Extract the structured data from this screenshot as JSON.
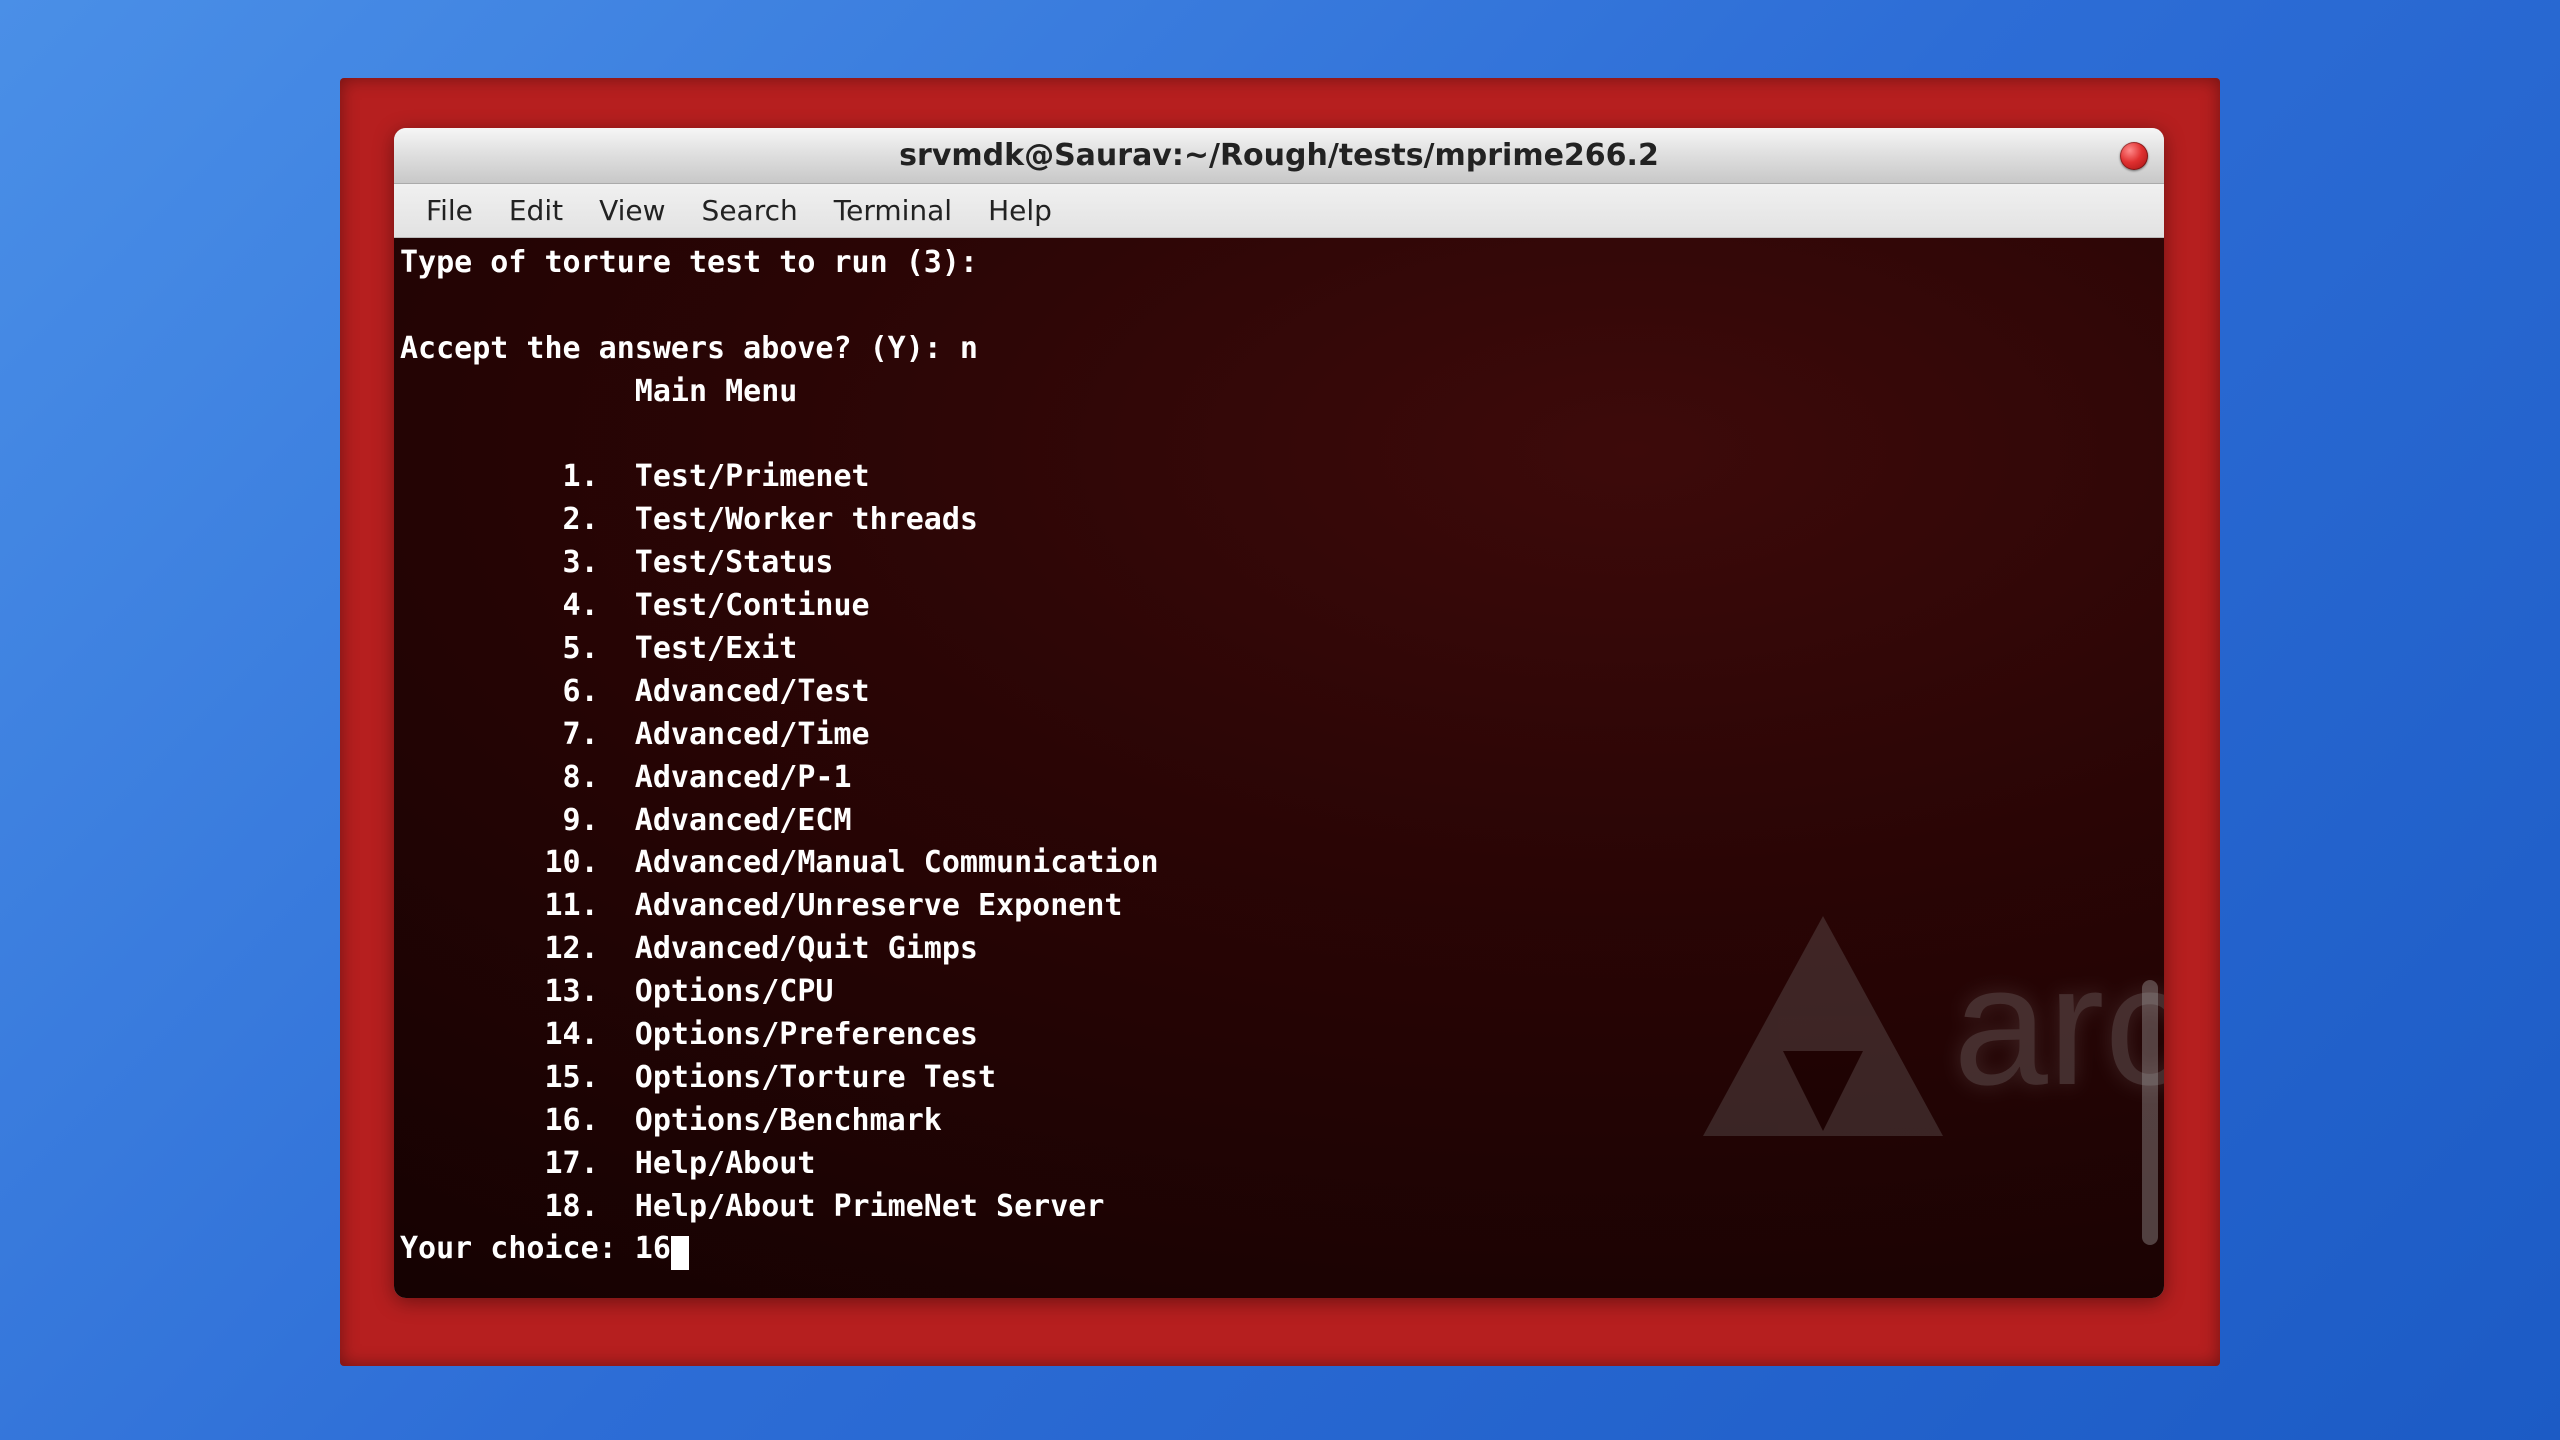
{
  "window": {
    "title": "srvmdk@Saurav:~/Rough/tests/mprime266.2"
  },
  "menubar": [
    "File",
    "Edit",
    "View",
    "Search",
    "Terminal",
    "Help"
  ],
  "terminal": {
    "line_torture": "Type of torture test to run (3):",
    "line_accept": "Accept the answers above? (Y): n",
    "main_menu_header": "Main Menu",
    "menu_items": [
      {
        "num": "1",
        "text": "Test/Primenet"
      },
      {
        "num": "2",
        "text": "Test/Worker threads"
      },
      {
        "num": "3",
        "text": "Test/Status"
      },
      {
        "num": "4",
        "text": "Test/Continue"
      },
      {
        "num": "5",
        "text": "Test/Exit"
      },
      {
        "num": "6",
        "text": "Advanced/Test"
      },
      {
        "num": "7",
        "text": "Advanced/Time"
      },
      {
        "num": "8",
        "text": "Advanced/P-1"
      },
      {
        "num": "9",
        "text": "Advanced/ECM"
      },
      {
        "num": "10",
        "text": "Advanced/Manual Communication"
      },
      {
        "num": "11",
        "text": "Advanced/Unreserve Exponent"
      },
      {
        "num": "12",
        "text": "Advanced/Quit Gimps"
      },
      {
        "num": "13",
        "text": "Options/CPU"
      },
      {
        "num": "14",
        "text": "Options/Preferences"
      },
      {
        "num": "15",
        "text": "Options/Torture Test"
      },
      {
        "num": "16",
        "text": "Options/Benchmark"
      },
      {
        "num": "17",
        "text": "Help/About"
      },
      {
        "num": "18",
        "text": "Help/About PrimeNet Server"
      }
    ],
    "prompt_label": "Your choice: ",
    "prompt_value": "16"
  },
  "watermark": {
    "text": "arch"
  }
}
